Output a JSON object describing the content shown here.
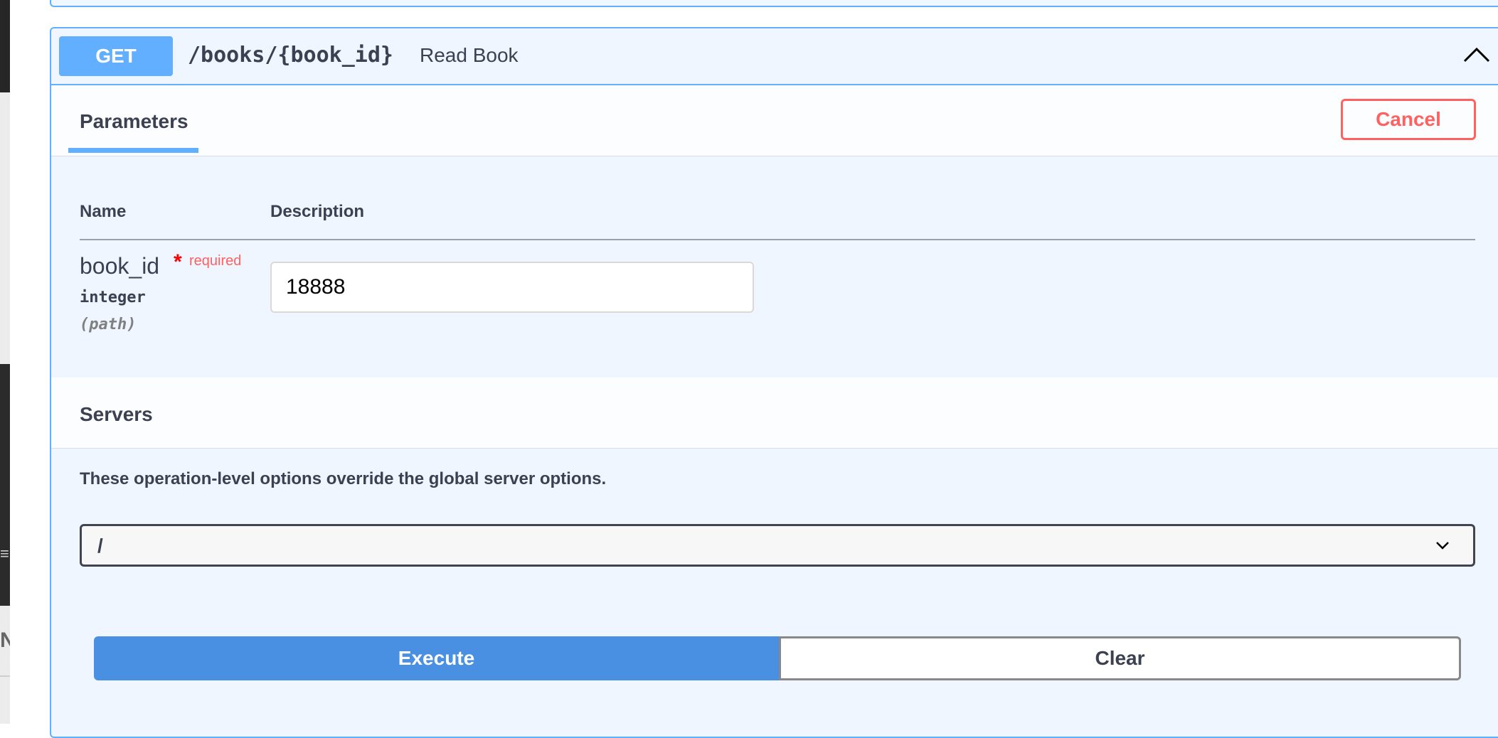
{
  "operation": {
    "method": "GET",
    "path": "/books/{book_id}",
    "summary": "Read Book",
    "method_color": "#61affe"
  },
  "tabs": {
    "parameters_label": "Parameters",
    "cancel_label": "Cancel"
  },
  "params_table": {
    "col_name": "Name",
    "col_description": "Description",
    "rows": [
      {
        "name": "book_id",
        "required_star": "*",
        "required_label": "required",
        "type": "integer",
        "in": "(path)",
        "value": "18888"
      }
    ]
  },
  "servers": {
    "title": "Servers",
    "note": "These operation-level options override the global server options.",
    "selected": "/"
  },
  "actions": {
    "execute_label": "Execute",
    "clear_label": "Clear"
  },
  "icons": {
    "collapse": "chevron-up-icon",
    "select": "chevron-down-icon"
  }
}
